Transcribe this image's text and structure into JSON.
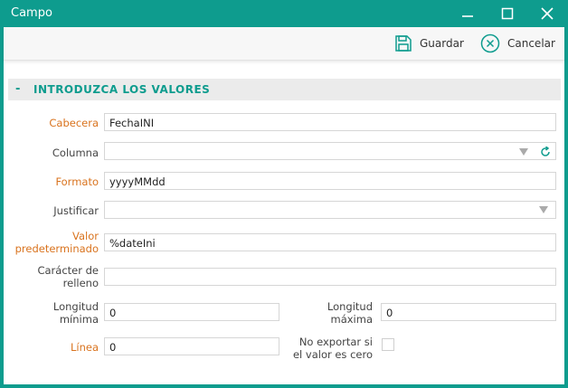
{
  "window": {
    "title": "Campo"
  },
  "toolbar": {
    "save_label": "Guardar",
    "cancel_label": "Cancelar"
  },
  "section": {
    "toggle": "-",
    "title": "INTRODUZCA LOS VALORES"
  },
  "form": {
    "cabecera": {
      "label": "Cabecera",
      "value": "FechaINI"
    },
    "columna": {
      "label": "Columna",
      "value": ""
    },
    "formato": {
      "label": "Formato",
      "value": "yyyyMMdd"
    },
    "justificar": {
      "label": "Justificar",
      "value": ""
    },
    "valor_predeterminado": {
      "label_line1": "Valor",
      "label_line2": "predeterminado",
      "value": "%dateIni"
    },
    "caracter_relleno": {
      "label_line1": "Carácter de",
      "label_line2": "relleno",
      "value": ""
    },
    "longitud_minima": {
      "label_line1": "Longitud",
      "label_line2": "mínima",
      "value": "0"
    },
    "longitud_maxima": {
      "label_line1": "Longitud",
      "label_line2": "máxima",
      "value": "0"
    },
    "linea": {
      "label": "Línea",
      "value": "0"
    },
    "no_exportar": {
      "label_line1": "No exportar si",
      "label_line2": "el valor es cero",
      "checked": false
    }
  },
  "colors": {
    "accent": "#0e9c8e",
    "required_label": "#d9731e"
  }
}
